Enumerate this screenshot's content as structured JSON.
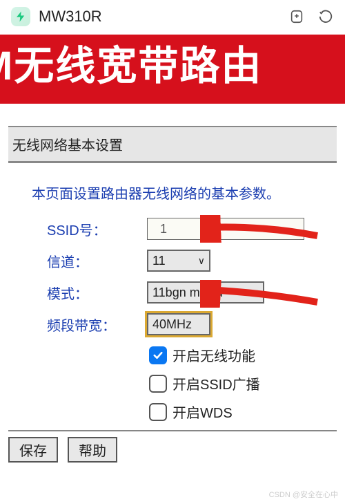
{
  "topbar": {
    "title": "MW310R"
  },
  "banner": {
    "text": "M无线宽带路由"
  },
  "section": {
    "title": "无线网络基本设置",
    "description": "本页面设置路由器无线网络的基本参数。"
  },
  "form": {
    "ssid_label": "SSID号：",
    "ssid_value": "  1",
    "channel_label": "信道：",
    "channel_value": "11",
    "mode_label": "模式：",
    "mode_value": "11bgn mixed",
    "bandwidth_label": "频段带宽：",
    "bandwidth_value": "40MHz"
  },
  "checks": {
    "enable_wifi": "开启无线功能",
    "enable_ssid": "开启SSID广播",
    "enable_wds": "开启WDS"
  },
  "buttons": {
    "save": "保存",
    "help": "帮助"
  },
  "watermark": "CSDN @安全在心中"
}
